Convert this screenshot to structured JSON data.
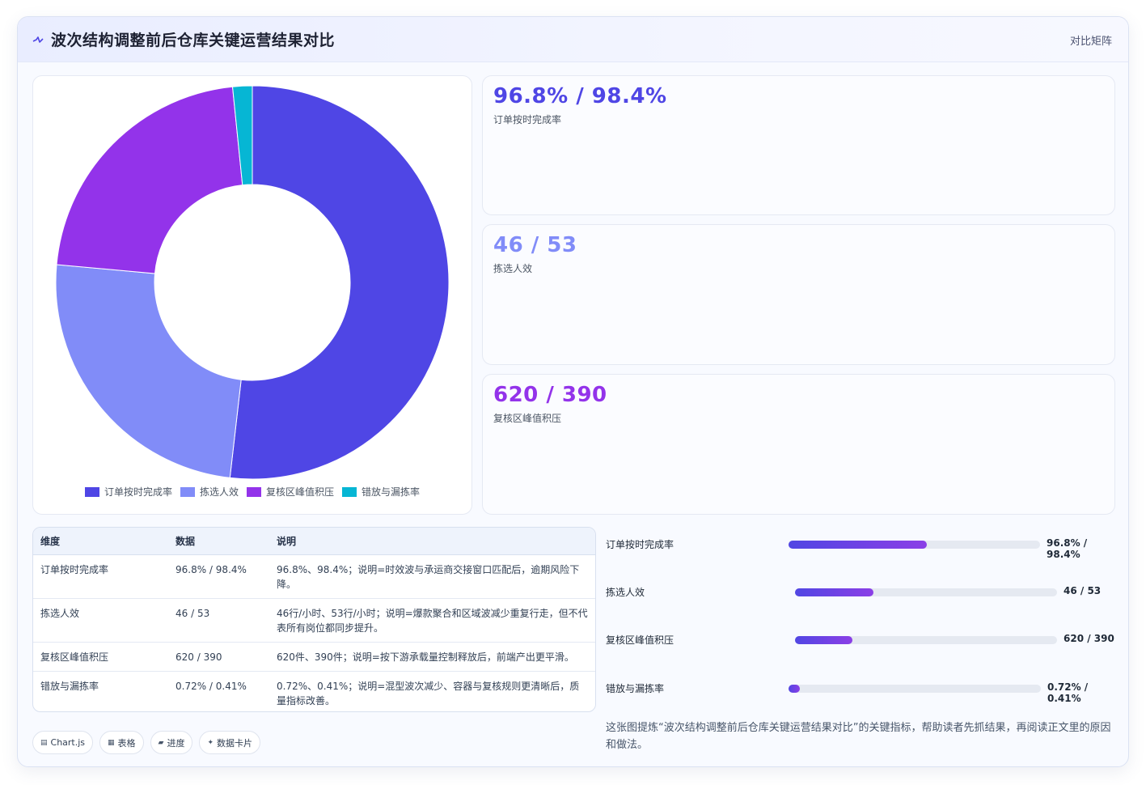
{
  "header": {
    "title": "波次结构调整前后仓库关键运营结果对比",
    "link": "对比矩阵"
  },
  "colors": {
    "series": [
      "#4f46e5",
      "#818cf8",
      "#9333ea",
      "#06b6d4"
    ],
    "accent": "#4f46e5"
  },
  "chart_data": {
    "type": "pie",
    "variant": "doughnut",
    "labels": [
      "订单按时完成率",
      "拣选人效",
      "复核区峰值积压",
      "错放与漏拣率"
    ],
    "values": [
      96.8,
      46,
      41,
      3
    ],
    "legend": "bottom"
  },
  "cards": [
    {
      "value": "96.8% / 98.4%",
      "label": "订单按时完成率",
      "color": "#4f46e5"
    },
    {
      "value": "46 / 53",
      "label": "拣选人效",
      "color": "#818cf8"
    },
    {
      "value": "620 / 390",
      "label": "复核区峰值积压",
      "color": "#9333ea"
    }
  ],
  "table": {
    "headers": [
      "维度",
      "数据",
      "说明"
    ],
    "rows": [
      [
        "订单按时完成率",
        "96.8% / 98.4%",
        "96.8%、98.4%；说明=时效波与承运商交接窗口匹配后，逾期风险下降。"
      ],
      [
        "拣选人效",
        "46 / 53",
        "46行/小时、53行/小时；说明=爆款聚合和区域波减少重复行走，但不代表所有岗位都同步提升。"
      ],
      [
        "复核区峰值积压",
        "620 / 390",
        "620件、390件；说明=按下游承载量控制释放后，前端产出更平滑。"
      ],
      [
        "错放与漏拣率",
        "0.72% / 0.41%",
        "0.72%、0.41%；说明=混型波次减少、容器与复核规则更清晰后，质量指标改善。"
      ]
    ]
  },
  "chips": [
    {
      "icon": "▤",
      "label": "Chart.js"
    },
    {
      "icon": "▦",
      "label": "表格"
    },
    {
      "icon": "▰",
      "label": "进度"
    },
    {
      "icon": "✦",
      "label": "数据卡片"
    }
  ],
  "progress": [
    {
      "label": "订单按时完成率",
      "value": "96.8% / 98.4%",
      "fill": 0.55
    },
    {
      "label": "拣选人效",
      "value": "46 / 53",
      "fill": 0.3
    },
    {
      "label": "复核区峰值积压",
      "value": "620 / 390",
      "fill": 0.22
    },
    {
      "label": "错放与漏拣率",
      "value": "0.72% / 0.41%",
      "fill": 0.045
    }
  ],
  "note": "这张图提炼“波次结构调整前后仓库关键运营结果对比”的关键指标，帮助读者先抓结果，再阅读正文里的原因和做法。"
}
